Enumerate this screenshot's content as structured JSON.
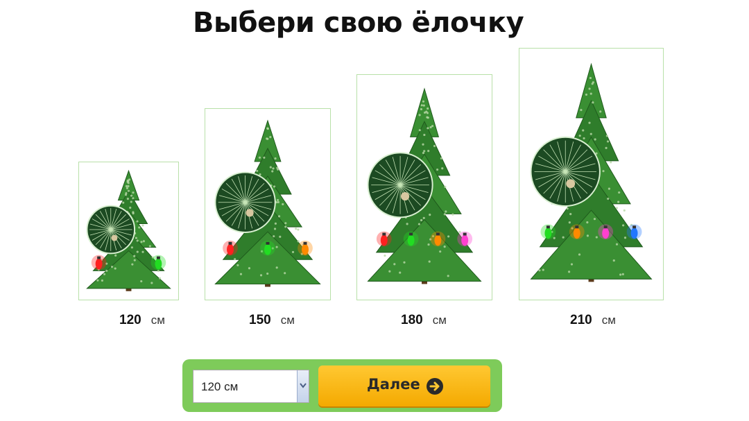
{
  "title": "Выбери свою ёлочку",
  "trees": [
    {
      "size": "120",
      "unit": "см",
      "lights": [
        "#ff2020",
        "#22dd22"
      ]
    },
    {
      "size": "150",
      "unit": "см",
      "lights": [
        "#ff2020",
        "#22dd22",
        "#ff8a00"
      ]
    },
    {
      "size": "180",
      "unit": "см",
      "lights": [
        "#ff2020",
        "#22dd22",
        "#ff8a00",
        "#ff40d0"
      ]
    },
    {
      "size": "210",
      "unit": "см",
      "lights": [
        "#22dd22",
        "#ff8a00",
        "#ff40d0",
        "#2277ff"
      ]
    }
  ],
  "size_select": {
    "value": "120 см"
  },
  "next_button": {
    "label": "Далее"
  },
  "colors": {
    "accent": "#7ecb5a",
    "button": "#f4a900",
    "tree": "#2d7a2a",
    "card_border": "#b8e0a8"
  }
}
